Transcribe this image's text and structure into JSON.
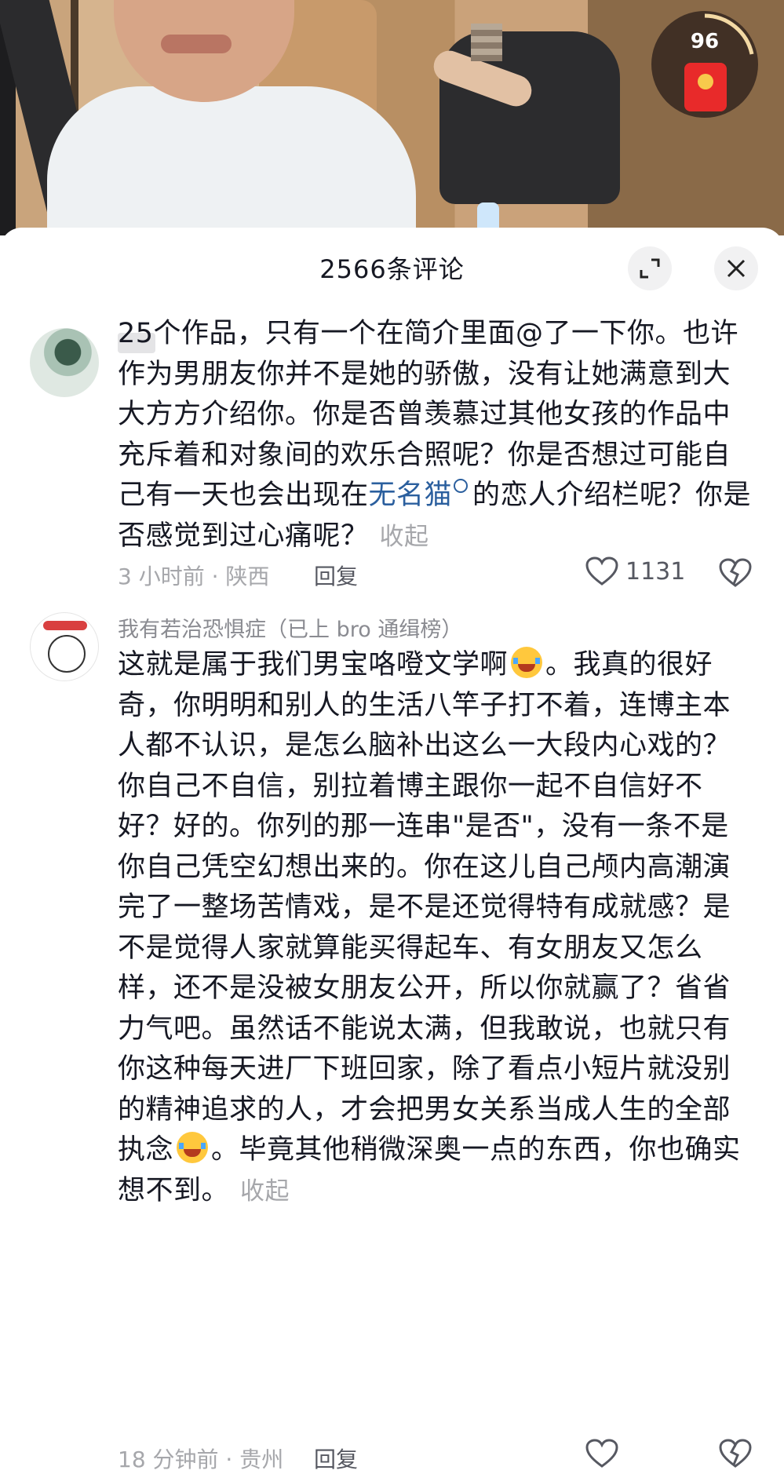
{
  "video": {
    "red_packet_count": "96"
  },
  "sheet": {
    "title": "2566条评论"
  },
  "comments": [
    {
      "username": "",
      "text_part1": "25个作品，只有一个在简介里面@了一下你。也许作为男朋友你并不是她的骄傲，没有让她满意到大大方方介绍你。你是否曾羡慕过其他女孩的作品中充斥着和对象间的欢乐合照呢？你是否想过可能自己有一天也会出现在",
      "link_text": "无名猫",
      "text_part2": "的恋人介绍栏呢？你是否感觉到过心痛呢？",
      "collapse": "收起",
      "meta": "3 小时前 · 陕西",
      "reply": "回复",
      "likes": "1131"
    },
    {
      "username": "我有若治恐惧症（已上 bro 通缉榜）",
      "text_part1": "这就是属于我们男宝咯噔文学啊",
      "text_part2": "。我真的很好奇，你明明和别人的生活八竿子打不着，连博主本人都不认识，是怎么脑补出这么一大段内心戏的？你自己不自信，别拉着博主跟你一起不自信好不好？好的。你列的那一连串\"是否\"，没有一条不是你自己凭空幻想出来的。你在这儿自己颅内高潮演完了一整场苦情戏，是不是还觉得特有成就感？是不是觉得人家就算能买得起车、有女朋友又怎么样，还不是没被女朋友公开，所以你就赢了？省省力气吧。虽然话不能说太满，但我敢说，也就只有你这种每天进厂下班回家，除了看点小短片就没别的精神追求的人，才会把男女关系当成人生的全部执念",
      "text_part3": "。毕竟其他稍微深奥一点的东西，你也确实想不到。",
      "collapse": "收起",
      "meta": "18 分钟前 · 贵州",
      "reply": "回复"
    }
  ],
  "icons": {
    "expand": "expand-icon",
    "close": "close-icon",
    "like": "heart-icon",
    "dislike": "broken-heart-icon",
    "emoji": "tears-of-joy-emoji",
    "red_packet": "red-packet-icon"
  },
  "colors": {
    "link": "#2b5f9e",
    "muted": "#a6a7ab",
    "text": "#161823"
  }
}
